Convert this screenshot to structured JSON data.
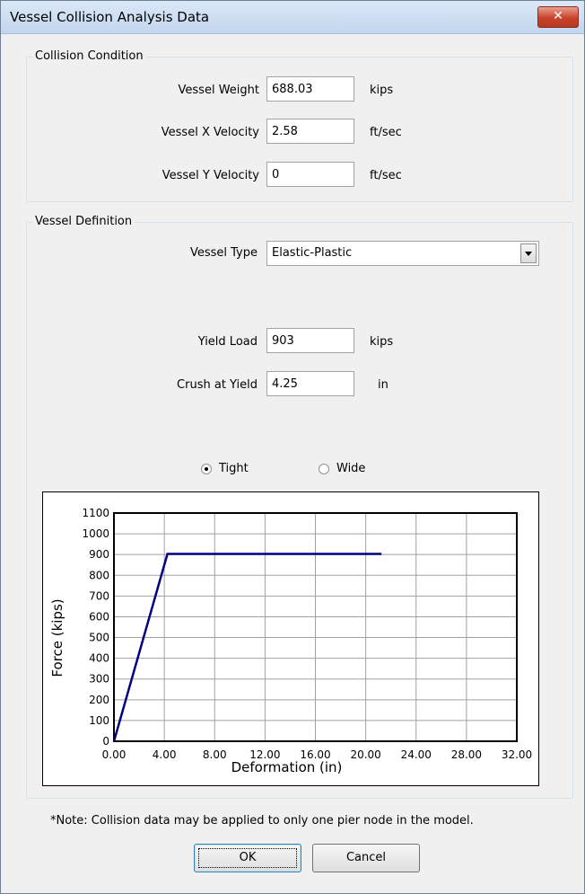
{
  "window": {
    "title": "Vessel Collision Analysis Data",
    "close_glyph": "✕"
  },
  "collision": {
    "legend": "Collision Condition",
    "rows": [
      {
        "label": "Vessel Weight",
        "value": "688.03",
        "unit": "kips"
      },
      {
        "label": "Vessel X Velocity",
        "value": "2.58",
        "unit": "ft/sec"
      },
      {
        "label": "Vessel Y Velocity",
        "value": "0",
        "unit": "ft/sec"
      }
    ]
  },
  "vessel": {
    "legend": "Vessel Definition",
    "type_label": "Vessel Type",
    "type_value": "Elastic-Plastic",
    "yield_load": {
      "label": "Yield Load",
      "value": "903",
      "unit": "kips"
    },
    "crush_yield": {
      "label": "Crush at Yield",
      "value": "4.25",
      "unit": "in"
    },
    "radio": {
      "tight": "Tight",
      "wide": "Wide",
      "selected": "tight"
    }
  },
  "chart_data": {
    "type": "line",
    "xlabel": "Deformation (in)",
    "ylabel": "Force (kips)",
    "xlim": [
      0,
      32
    ],
    "ylim": [
      0,
      1100
    ],
    "xticks": [
      "0.00",
      "4.00",
      "8.00",
      "12.00",
      "16.00",
      "20.00",
      "24.00",
      "28.00",
      "32.00"
    ],
    "yticks": [
      "0",
      "100",
      "200",
      "300",
      "400",
      "500",
      "600",
      "700",
      "800",
      "900",
      "1000",
      "1100"
    ],
    "grid": true,
    "series": [
      {
        "x": [
          0,
          4.25,
          21.25
        ],
        "y": [
          0,
          903,
          903
        ],
        "color": "#000080"
      }
    ]
  },
  "note": "*Note: Collision data may be applied to only one pier node in the model.",
  "buttons": {
    "ok": "OK",
    "cancel": "Cancel"
  }
}
